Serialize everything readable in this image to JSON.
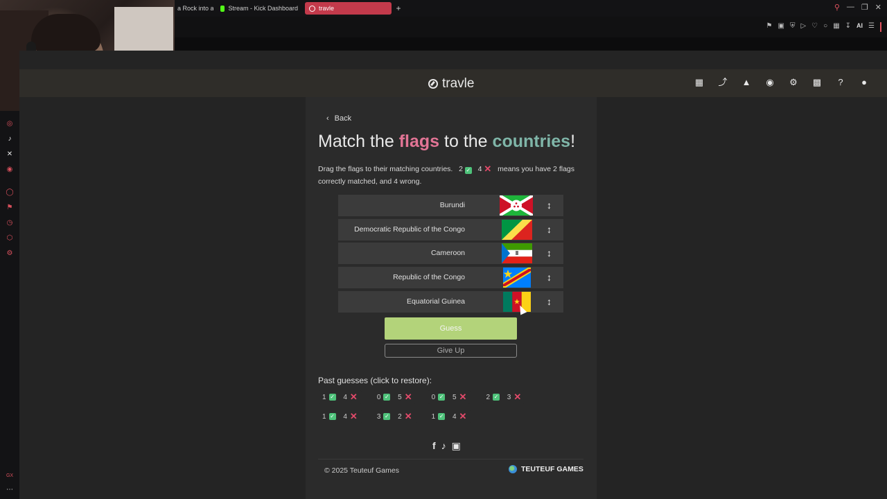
{
  "browser": {
    "tabs": [
      {
        "label": "a Rock into a",
        "active": false
      },
      {
        "label": "Stream - Kick Dashboard",
        "active": false
      },
      {
        "label": "travle",
        "active": true
      }
    ],
    "new_tab": "+",
    "ai_label": "AI"
  },
  "site": {
    "logo_text": "travle",
    "header_icons": [
      "calendar-icon",
      "route-icon",
      "graduation-cap-icon",
      "gamepad-icon",
      "gear-icon",
      "bar-chart-icon",
      "help-icon",
      "user-icon"
    ]
  },
  "game": {
    "back_label": "Back",
    "title": {
      "part1": "Match the ",
      "flags": "flags",
      "part2": " to the ",
      "countries": "countries",
      "part3": "!"
    },
    "instructions": {
      "lead": "Drag the flags to their matching countries.",
      "correct_example": "2",
      "wrong_example": "4",
      "tail": "means you have 2 flags correctly matched, and 4 wrong."
    },
    "rows": [
      {
        "country": "Burundi",
        "flag": "burundi"
      },
      {
        "country": "Democratic Republic of the Congo",
        "flag": "congo"
      },
      {
        "country": "Cameroon",
        "flag": "equatorial-guinea"
      },
      {
        "country": "Republic of the Congo",
        "flag": "drc"
      },
      {
        "country": "Equatorial Guinea",
        "flag": "cameroon"
      }
    ],
    "guess_label": "Guess",
    "give_up_label": "Give Up",
    "past_title": "Past guesses (click to restore):",
    "past_guesses": [
      {
        "correct": "1",
        "wrong": "4"
      },
      {
        "correct": "0",
        "wrong": "5"
      },
      {
        "correct": "0",
        "wrong": "5"
      },
      {
        "correct": "2",
        "wrong": "3"
      },
      {
        "correct": "1",
        "wrong": "4"
      },
      {
        "correct": "3",
        "wrong": "2"
      },
      {
        "correct": "1",
        "wrong": "4"
      }
    ]
  },
  "footer": {
    "copyright": "© 2025 Teuteuf Games",
    "brand": "TEUTEUF GAMES"
  },
  "colors": {
    "accent_pink": "#e27495",
    "accent_teal": "#7fb5a8",
    "guess_green": "#b3d37a"
  }
}
